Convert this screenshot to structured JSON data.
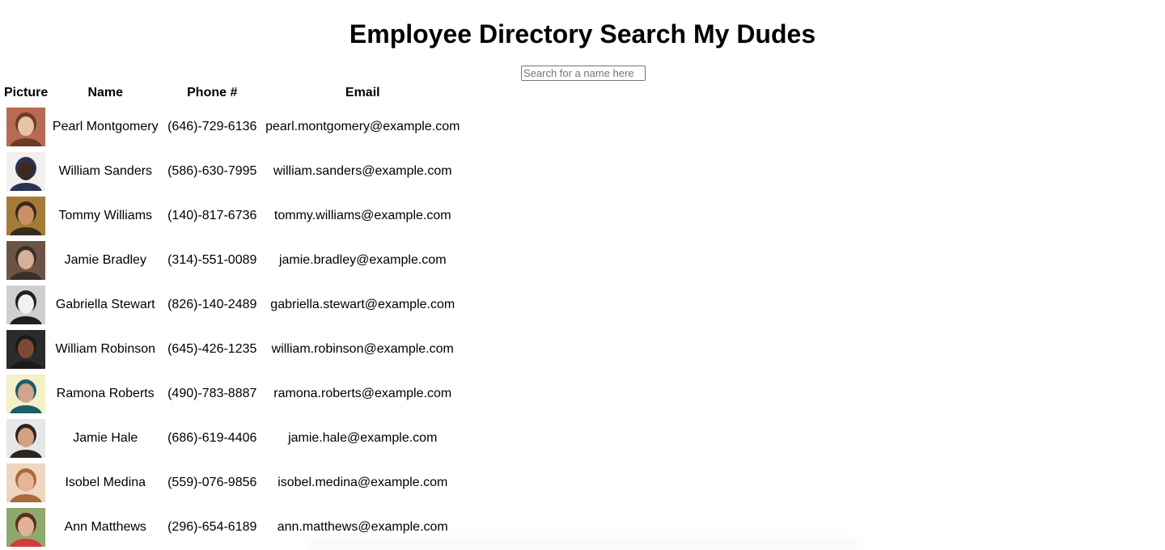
{
  "header": {
    "title": "Employee Directory Search My Dudes"
  },
  "search": {
    "placeholder": "Search for a name here",
    "value": ""
  },
  "table": {
    "columns": [
      "Picture",
      "Name",
      "Phone #",
      "Email"
    ],
    "rows": [
      {
        "name": "Pearl Montgomery",
        "phone": "(646)-729-6136",
        "email": "pearl.montgomery@example.com",
        "avatar_bg": "#b86a52",
        "avatar_fg": "#e7c3a6",
        "avatar_hair": "#6b3b26"
      },
      {
        "name": "William Sanders",
        "phone": "(586)-630-7995",
        "email": "william.sanders@example.com",
        "avatar_bg": "#f2f0ee",
        "avatar_fg": "#3b2a22",
        "avatar_hair": "#2a3355"
      },
      {
        "name": "Tommy Williams",
        "phone": "(140)-817-6736",
        "email": "tommy.williams@example.com",
        "avatar_bg": "#a57b3a",
        "avatar_fg": "#c98f68",
        "avatar_hair": "#3a2a1e"
      },
      {
        "name": "Jamie Bradley",
        "phone": "(314)-551-0089",
        "email": "jamie.bradley@example.com",
        "avatar_bg": "#6c5444",
        "avatar_fg": "#d6b09a",
        "avatar_hair": "#3b2f2a"
      },
      {
        "name": "Gabriella Stewart",
        "phone": "(826)-140-2489",
        "email": "gabriella.stewart@example.com",
        "avatar_bg": "#cfcfcf",
        "avatar_fg": "#f1f1f1",
        "avatar_hair": "#1f1f1f"
      },
      {
        "name": "William Robinson",
        "phone": "(645)-426-1235",
        "email": "william.robinson@example.com",
        "avatar_bg": "#2b2b2b",
        "avatar_fg": "#7a4a33",
        "avatar_hair": "#1a1a1a"
      },
      {
        "name": "Ramona Roberts",
        "phone": "(490)-783-8887",
        "email": "ramona.roberts@example.com",
        "avatar_bg": "#f4f0c8",
        "avatar_fg": "#cfa58c",
        "avatar_hair": "#1c5d6c"
      },
      {
        "name": "Jamie Hale",
        "phone": "(686)-619-4406",
        "email": "jamie.hale@example.com",
        "avatar_bg": "#e7e7ea",
        "avatar_fg": "#d3a283",
        "avatar_hair": "#2d2520"
      },
      {
        "name": "Isobel Medina",
        "phone": "(559)-076-9856",
        "email": "isobel.medina@example.com",
        "avatar_bg": "#f0d6bf",
        "avatar_fg": "#e7b496",
        "avatar_hair": "#a66a3c"
      },
      {
        "name": "Ann Matthews",
        "phone": "(296)-654-6189",
        "email": "ann.matthews@example.com",
        "avatar_bg": "#8fa86b",
        "avatar_fg": "#e2b19a",
        "avatar_hair": "#5a2e1e",
        "avatar_shirt": "#d33a3a"
      }
    ]
  }
}
